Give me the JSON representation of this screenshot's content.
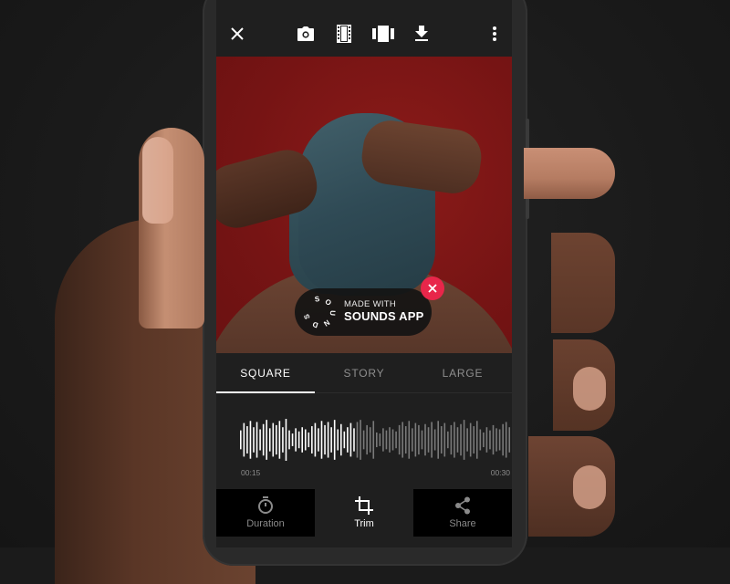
{
  "toolbar": {
    "icons": [
      "close-icon",
      "camera-icon",
      "film-icon",
      "carousel-icon",
      "download-icon",
      "more-vertical-icon"
    ]
  },
  "watermark": {
    "logo_letters": [
      "S",
      "O",
      "U",
      "N",
      "D",
      "S"
    ],
    "line1": "MADE WITH",
    "line2": "SOUNDS APP",
    "accent": "#e8264a"
  },
  "tabs": [
    {
      "label": "SQUARE",
      "active": true
    },
    {
      "label": "STORY",
      "active": false
    },
    {
      "label": "LARGE",
      "active": false
    }
  ],
  "waveform": {
    "start_time": "00:15",
    "end_time": "00:30",
    "played_fraction": 0.43,
    "bars": [
      0.45,
      0.8,
      0.65,
      0.9,
      0.6,
      0.85,
      0.5,
      0.75,
      0.95,
      0.55,
      0.8,
      0.7,
      0.9,
      0.6,
      1.0,
      0.45,
      0.3,
      0.55,
      0.4,
      0.6,
      0.5,
      0.35,
      0.65,
      0.8,
      0.55,
      0.9,
      0.7,
      0.85,
      0.6,
      0.95,
      0.5,
      0.75,
      0.4,
      0.6,
      0.8,
      0.55,
      0.85,
      0.95,
      0.45,
      0.7,
      0.6,
      0.9,
      0.35,
      0.3,
      0.55,
      0.45,
      0.6,
      0.5,
      0.4,
      0.7,
      0.85,
      0.65,
      0.9,
      0.55,
      0.8,
      0.7,
      0.45,
      0.75,
      0.6,
      0.85,
      0.5,
      0.9,
      0.65,
      0.8,
      0.4,
      0.7,
      0.85,
      0.6,
      0.75,
      0.95,
      0.55,
      0.8,
      0.65,
      0.9,
      0.5,
      0.35,
      0.6,
      0.45,
      0.7,
      0.55,
      0.5,
      0.75,
      0.85,
      0.6
    ]
  },
  "actions": [
    {
      "label": "Duration",
      "icon": "stopwatch-icon",
      "active": false
    },
    {
      "label": "Trim",
      "icon": "crop-icon",
      "active": true
    },
    {
      "label": "Share",
      "icon": "share-icon",
      "active": false
    }
  ],
  "colors": {
    "screen_bg": "#1f1f1f",
    "photo_bg": "#7a1616",
    "tab_active": "#ffffff",
    "tab_inactive": "#8e8e8e",
    "wave_played": "#ffffff",
    "wave_unplayed": "#7a7a7a"
  }
}
